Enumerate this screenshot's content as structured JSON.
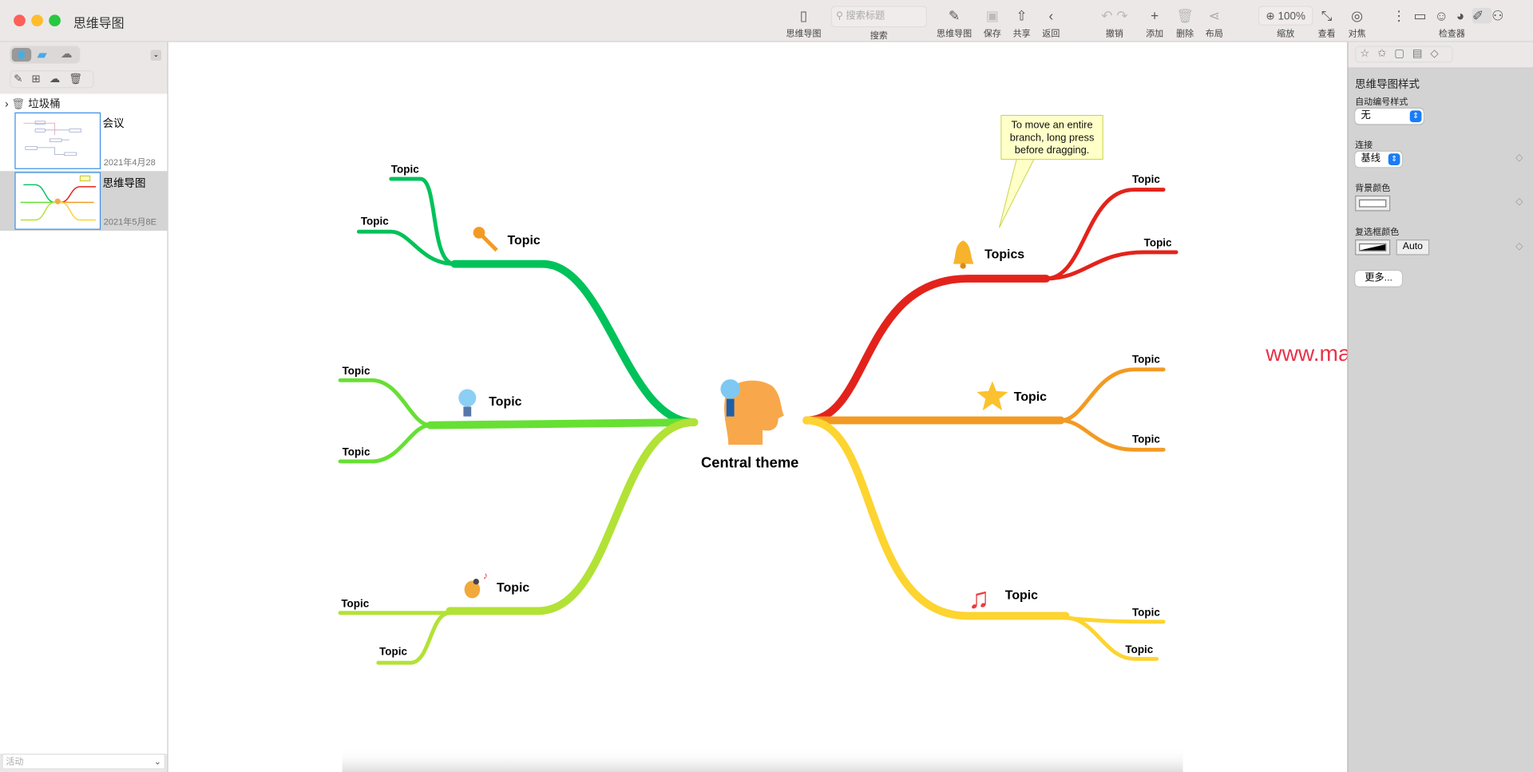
{
  "window": {
    "title": "思维导图"
  },
  "toolbar": {
    "mindmap_view": "思维导图",
    "search_placeholder": "搜索标题",
    "search": "搜索",
    "new_mindmap": "思维导图",
    "save": "保存",
    "share": "共享",
    "back": "返回",
    "undo": "撤销",
    "add": "添加",
    "delete": "删除",
    "layout": "布局",
    "zoom_value": "100%",
    "zoom": "缩放",
    "view": "查看",
    "focus": "对焦",
    "inspector": "检查器"
  },
  "sidebar": {
    "trash": "垃圾桶",
    "documents": [
      {
        "name": "会议",
        "date": "2021年4月28"
      },
      {
        "name": "思维导图",
        "date": "2021年5月8E",
        "selected": true
      }
    ],
    "filter": "活动"
  },
  "mindmap": {
    "central": "Central theme",
    "callout": [
      "To move an entire",
      "branch, long press",
      "before dragging."
    ],
    "branches": [
      {
        "label": "Topic",
        "icon": "key-icon",
        "color": "#00c25a",
        "children": [
          "Topic",
          "Topic"
        ]
      },
      {
        "label": "Topic",
        "icon": "lightbulb-icon",
        "color": "#66e033",
        "children": [
          "Topic",
          "Topic"
        ]
      },
      {
        "label": "Topic",
        "icon": "bird-icon",
        "color": "#b2e236",
        "children": [
          "Topic",
          "Topic"
        ]
      },
      {
        "label": "Topics",
        "icon": "bell-icon",
        "color": "#e3231b",
        "children": [
          "Topic",
          "Topic"
        ]
      },
      {
        "label": "Topic",
        "icon": "star-icon",
        "color": "#f39a23",
        "children": [
          "Topic",
          "Topic"
        ]
      },
      {
        "label": "Topic",
        "icon": "music-note-icon",
        "color": "#fdd430",
        "children": [
          "Topic",
          "Topic"
        ]
      }
    ],
    "watermark": "www.macfuwu.com"
  },
  "inspector": {
    "section_title": "思维导图样式",
    "numbering_label": "自动编号样式",
    "numbering_value": "无",
    "connection_label": "连接",
    "connection_value": "基线",
    "bg_color_label": "背景颜色",
    "checkbox_color_label": "复选框颜色",
    "checkbox_auto": "Auto",
    "more_button": "更多..."
  }
}
